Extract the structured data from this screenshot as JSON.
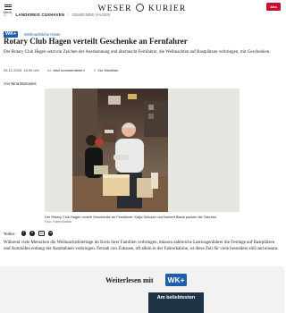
{
  "header": {
    "menu_label": "Menü",
    "logo_left": "WESER",
    "logo_right": "KURIER",
    "abo_button": "Abo"
  },
  "breadcrumb": [
    "LANDKREIS CUXHAVEN",
    "GEMEINDE HAGEN"
  ],
  "article": {
    "badge": "WK+",
    "category": "Weihnachtliche Geste",
    "headline": "Rotary Club Hagen verteilt Geschenke an Fernfahrer",
    "teaser": "Der Rotary Club Hagen setzt ein Zeichen der Anerkennung und überrascht Fernfahrer, die Weihnachten auf Rastplätzen verbringen, mit Geschenken.",
    "date": "25.12.2025, 15:00 Uhr",
    "comment_action": "Jetzt kommentieren!",
    "bookmark_action": "Zur Merkliste",
    "author_prefix": "Von",
    "author_name": "Nina Momanes",
    "caption": "Der Rotary Club Hagen verteilt Geschenke an Fernfahrer: Katja Schulze und Norbert Blank packen die Taschen.",
    "credit": "Foto: Katrin Kurths",
    "body": "Während viele Menschen die Weihnachtsfeiertage im Kreis ihrer Familien verbringen, müssen zahlreiche Lastwagenfahrer die Festtage auf Rastplätzen und Autohöfen entlang der Autobahnen verbringen. Fernab von Zuhause, oft allein in der Fahrerkabine, ist diese Zeit für viele besonders still und einsam."
  },
  "share": {
    "label": "Teilen:"
  },
  "paywall": {
    "text": "Weiterlesen mit",
    "badge": "WK+"
  },
  "panel": {
    "title": "Am beliebtesten"
  },
  "colors": {
    "accent_blue": "#1c5fa8",
    "abo_red": "#c8102e",
    "panel_navy": "#1f3346"
  },
  "icons": [
    "menu-icon",
    "home-icon",
    "comment-icon",
    "bookmark-icon",
    "facebook-icon",
    "x-icon",
    "email-icon",
    "whatsapp-icon"
  ]
}
